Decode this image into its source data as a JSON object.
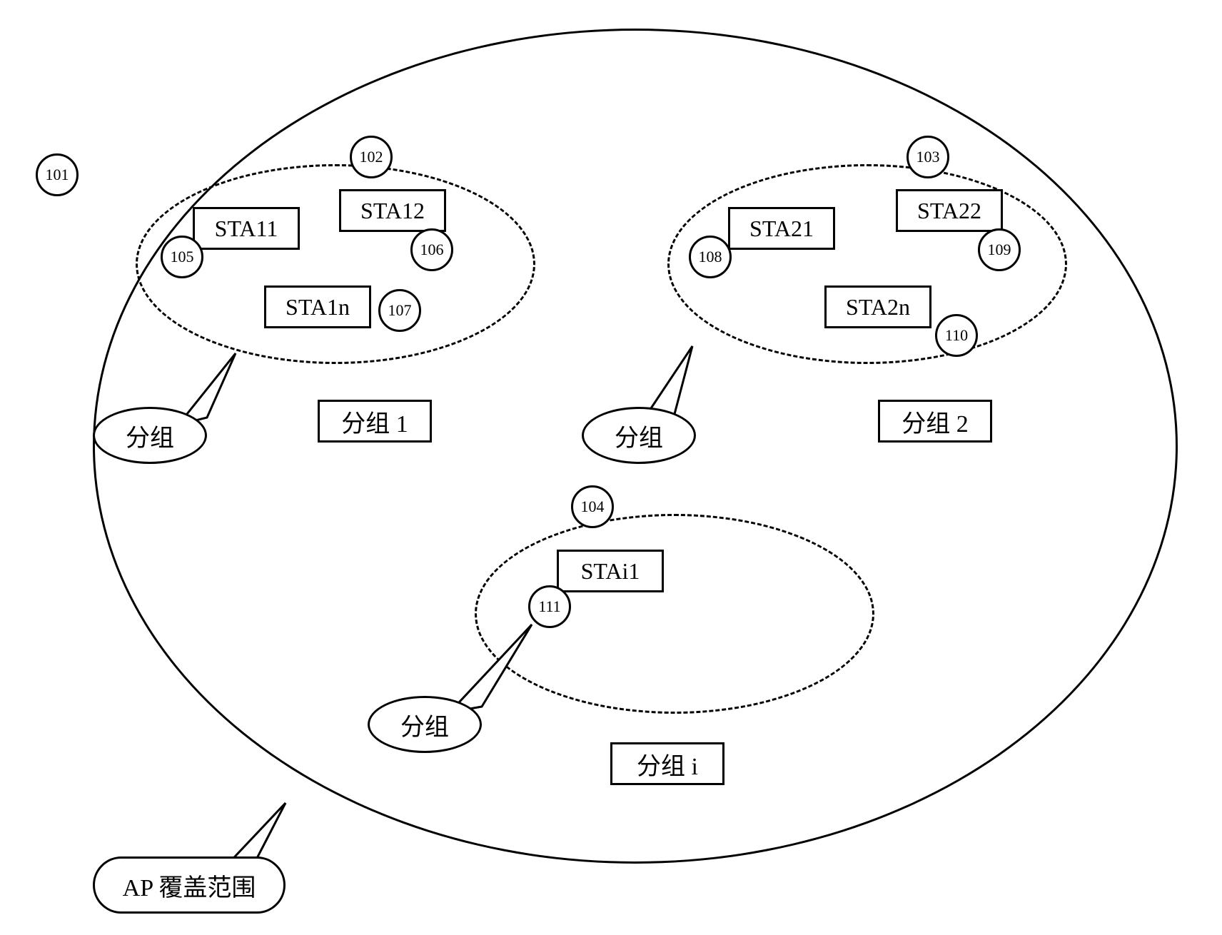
{
  "diagram": {
    "main_circle": {},
    "numbers": {
      "n101": "101",
      "n102": "102",
      "n103": "103",
      "n104": "104",
      "n105": "105",
      "n106": "106",
      "n107": "107",
      "n108": "108",
      "n109": "109",
      "n110": "110",
      "n111": "111"
    },
    "stations": {
      "sta11": "STA11",
      "sta12": "STA12",
      "sta1n": "STA1n",
      "sta21": "STA21",
      "sta22": "STA22",
      "sta2n": "STA2n",
      "stai1": "STAi1"
    },
    "groups": {
      "group1": "分组 1",
      "group2": "分组 2",
      "groupi": "分组 i"
    },
    "callouts": {
      "group_label": "分组",
      "coverage_label": "AP 覆盖范围"
    }
  }
}
